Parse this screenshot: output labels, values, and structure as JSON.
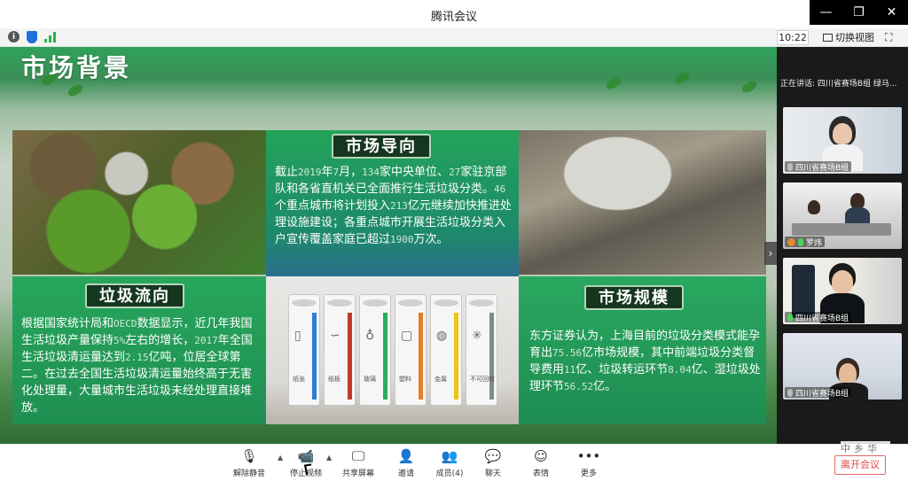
{
  "window": {
    "title": "腾讯会议",
    "controls": {
      "minimize": "—",
      "maximize": "❐",
      "close": "✕"
    }
  },
  "infobar": {
    "icons": [
      "info-icon",
      "shield-icon",
      "signal-icon"
    ],
    "clock": "10:22",
    "switch_view": "切换视图",
    "fullscreen_icon": "fullscreen-icon"
  },
  "slide": {
    "title": "市场背景",
    "cards": {
      "market_orientation": {
        "title": "市场导向",
        "parts": [
          "截止",
          "2019",
          "年",
          "7",
          "月，",
          "134",
          "家中央单位、",
          "27",
          "家驻京部队和各省直机关已全面推行生活垃圾分类。",
          "46",
          "个重点城市将计划投入",
          "213",
          "亿元继续加快推进处理设施建设；各重点城市开展生活垃圾分类入户宣传覆盖家庭已超过",
          "1900",
          "万次。"
        ]
      },
      "waste_flow": {
        "title": "垃圾流向",
        "parts": [
          "根据国家统计局和",
          "OECD",
          "数据显示，近几年我国生活垃圾产量保持",
          "5%",
          "左右的增长，",
          "2017",
          "年全国生活垃圾清运量达到",
          "2.15",
          "亿吨，位居全球第二。在过去全国生活垃圾清运量始终高于无害化处理量，大量城市生活垃圾未经处理直接堆放。"
        ]
      },
      "market_scale": {
        "title": "市场规模",
        "parts": [
          "东方证券认为，上海目前的垃圾分类模式能孕育出",
          "75.56",
          "亿市场规模，其中前端垃圾分类督导费用",
          "11",
          "亿、垃圾转运环节",
          "8.04",
          "亿、湿垃圾处理环节",
          "56.52",
          "亿。"
        ]
      }
    },
    "bins": [
      {
        "label": "纸张",
        "color": "#2a7fd4",
        "glyph": "▯"
      },
      {
        "label": "纸板",
        "color": "#c0392b",
        "glyph": "∽"
      },
      {
        "label": "玻璃",
        "color": "#27ae60",
        "glyph": "♁"
      },
      {
        "label": "塑料",
        "color": "#e67e22",
        "glyph": "▢"
      },
      {
        "label": "金属",
        "color": "#f1c40f",
        "glyph": "◍"
      },
      {
        "label": "不可回收",
        "color": "#7f8c8d",
        "glyph": "✳"
      }
    ],
    "next_arrow": "›"
  },
  "sidebar": {
    "speaking": "正在讲话: 四川省赛场B组 绿马...",
    "participants": [
      {
        "name": "四川省赛场B组",
        "mic": "off"
      },
      {
        "name": "罗炜",
        "mic": "on"
      },
      {
        "name": "四川省赛场B组",
        "mic": "on"
      },
      {
        "name": "四川省赛场B组",
        "mic": "off"
      }
    ]
  },
  "toolbar": {
    "buttons": [
      {
        "id": "unmute",
        "label": "解除静音",
        "icon": "🎙"
      },
      {
        "id": "stop-video",
        "label": "停止视频",
        "icon": "📹"
      },
      {
        "id": "share-screen",
        "label": "共享屏幕",
        "icon": "🖵"
      },
      {
        "id": "invite",
        "label": "邀请",
        "icon": "👤"
      },
      {
        "id": "members",
        "label": "成员(4)",
        "icon": "👥"
      },
      {
        "id": "chat",
        "label": "聊天",
        "icon": "💬"
      },
      {
        "id": "reactions",
        "label": "表情",
        "icon": "☺"
      },
      {
        "id": "more",
        "label": "更多",
        "icon": "•••"
      }
    ],
    "leave": "离开会议",
    "stamp": "中乡华"
  },
  "colors": {
    "accent_green": "#23a35a",
    "tag_dark": "#15361f",
    "leave_red": "#e24848"
  }
}
